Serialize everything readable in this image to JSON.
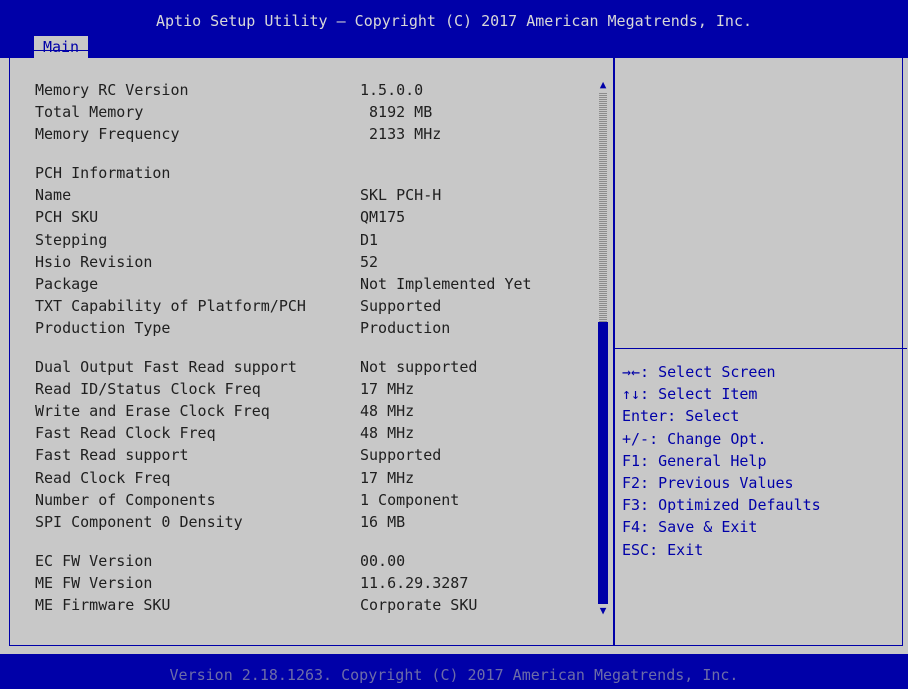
{
  "header": {
    "title": "Aptio Setup Utility – Copyright (C) 2017 American Megatrends, Inc.",
    "tabs": [
      "Main"
    ]
  },
  "info": [
    {
      "label": "Memory RC Version",
      "value": "1.5.0.0"
    },
    {
      "label": "Total Memory",
      "value": " 8192 MB"
    },
    {
      "label": "Memory Frequency",
      "value": " 2133 MHz"
    },
    {
      "label": "",
      "value": ""
    },
    {
      "label": "PCH Information",
      "value": ""
    },
    {
      "label": "Name",
      "value": "SKL PCH-H"
    },
    {
      "label": "PCH SKU",
      "value": "QM175"
    },
    {
      "label": "Stepping",
      "value": "D1"
    },
    {
      "label": "Hsio Revision",
      "value": "52"
    },
    {
      "label": "Package",
      "value": "Not Implemented Yet"
    },
    {
      "label": "TXT Capability of Platform/PCH",
      "value": "Supported"
    },
    {
      "label": "Production Type",
      "value": "Production"
    },
    {
      "label": "",
      "value": ""
    },
    {
      "label": "Dual Output Fast Read support",
      "value": "Not supported"
    },
    {
      "label": "Read ID/Status Clock Freq",
      "value": "17 MHz"
    },
    {
      "label": "Write and Erase Clock Freq",
      "value": "48 MHz"
    },
    {
      "label": "Fast Read Clock Freq",
      "value": "48 MHz"
    },
    {
      "label": "Fast Read support",
      "value": "Supported"
    },
    {
      "label": "Read Clock Freq",
      "value": "17 MHz"
    },
    {
      "label": "Number of Components",
      "value": "1 Component"
    },
    {
      "label": "SPI Component 0 Density",
      "value": "16 MB"
    },
    {
      "label": "",
      "value": ""
    },
    {
      "label": "EC FW Version",
      "value": "00.00"
    },
    {
      "label": "ME FW Version",
      "value": "11.6.29.3287"
    },
    {
      "label": "ME Firmware SKU",
      "value": "Corporate SKU"
    }
  ],
  "scroll": {
    "up_glyph": "▲",
    "down_glyph": "▼",
    "position_fraction": 0.46
  },
  "help": [
    "→←: Select Screen",
    "↑↓: Select Item",
    "Enter: Select",
    "+/-: Change Opt.",
    "F1: General Help",
    "F2: Previous Values",
    "F3: Optimized Defaults",
    "F4: Save & Exit",
    "ESC: Exit"
  ],
  "footer": "Version 2.18.1263. Copyright (C) 2017 American Megatrends, Inc.",
  "colors": {
    "blue": "#0000a8",
    "gray": "#c8c8c8",
    "text": "#202020",
    "title": "#d8d8d8",
    "footer_text": "#6c6ca8"
  }
}
